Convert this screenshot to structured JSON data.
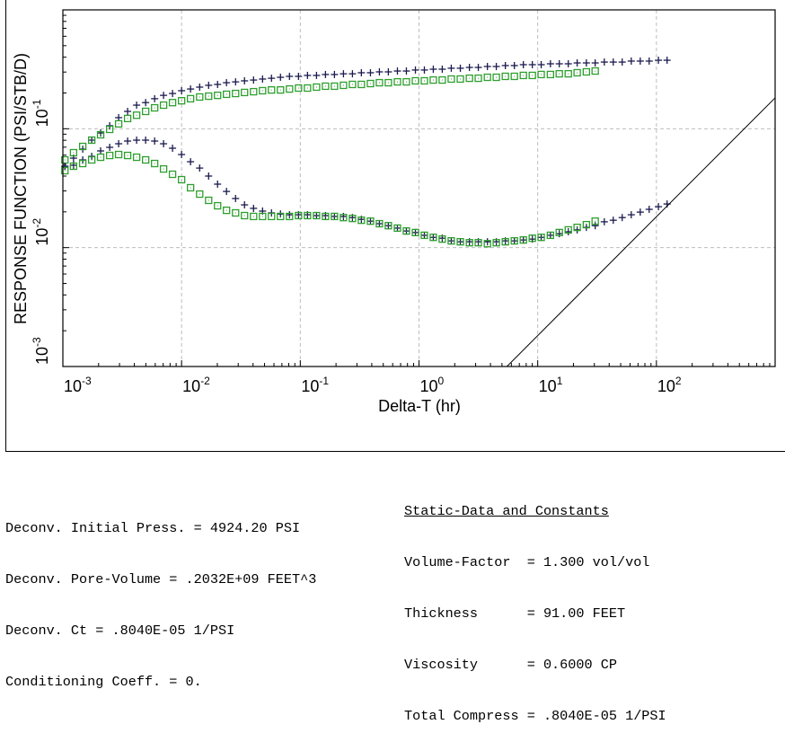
{
  "chart_data": {
    "type": "scatter",
    "title": "",
    "xlabel": "Delta-T (hr)",
    "ylabel": "RESPONSE FUNCTION (PSI/STB/D)",
    "xscale": "log",
    "yscale": "log",
    "xlim": [
      0.001,
      1000
    ],
    "ylim": [
      0.001,
      1
    ],
    "grid": true,
    "legend": "none",
    "x_ticks": [
      {
        "base": "10",
        "exp": "-3"
      },
      {
        "base": "10",
        "exp": "-2"
      },
      {
        "base": "10",
        "exp": "-1"
      },
      {
        "base": "10",
        "exp": "0"
      },
      {
        "base": "10",
        "exp": "1"
      },
      {
        "base": "10",
        "exp": "2"
      }
    ],
    "y_ticks": [
      {
        "base": "10",
        "exp": "-3"
      },
      {
        "base": "10",
        "exp": "-2"
      },
      {
        "base": "10",
        "exp": "-1"
      }
    ],
    "x": [
      0.00104,
      0.00123,
      0.00147,
      0.00175,
      0.00208,
      0.00248,
      0.00295,
      0.00351,
      0.00418,
      0.00498,
      0.00593,
      0.00705,
      0.00839,
      0.01,
      0.0119,
      0.0142,
      0.0169,
      0.0201,
      0.0239,
      0.0285,
      0.0339,
      0.0404,
      0.0481,
      0.0572,
      0.0681,
      0.0811,
      0.0966,
      0.115,
      0.137,
      0.163,
      0.194,
      0.231,
      0.275,
      0.327,
      0.39,
      0.464,
      0.552,
      0.658,
      0.783,
      0.933,
      1.11,
      1.32,
      1.57,
      1.87,
      2.23,
      2.66,
      3.16,
      3.77,
      4.48,
      5.34,
      6.36,
      7.57,
      9.01,
      10.7,
      12.8,
      15.2,
      18.1,
      21.5,
      25.7,
      30.5,
      36.4,
      43.3,
      51.5,
      61.4,
      73.1,
      86.9,
      104,
      123
    ],
    "series": [
      {
        "name": "response-plus",
        "marker": "plus",
        "color": "#1a1a4e",
        "values": [
          0.0484,
          0.0566,
          0.0674,
          0.0802,
          0.0922,
          0.106,
          0.124,
          0.14,
          0.158,
          0.166,
          0.179,
          0.191,
          0.198,
          0.209,
          0.216,
          0.224,
          0.232,
          0.236,
          0.244,
          0.248,
          0.253,
          0.257,
          0.262,
          0.266,
          0.271,
          0.276,
          0.276,
          0.281,
          0.281,
          0.286,
          0.286,
          0.29,
          0.29,
          0.296,
          0.296,
          0.301,
          0.301,
          0.306,
          0.306,
          0.312,
          0.312,
          0.317,
          0.317,
          0.323,
          0.323,
          0.328,
          0.328,
          0.334,
          0.334,
          0.34,
          0.34,
          0.346,
          0.346,
          0.346,
          0.352,
          0.352,
          0.352,
          0.358,
          0.358,
          0.358,
          0.364,
          0.364,
          0.364,
          0.371,
          0.371,
          0.371,
          0.377,
          0.377
        ]
      },
      {
        "name": "response-square",
        "marker": "square",
        "color": "#2e9e2e",
        "values": [
          0.0547,
          0.0629,
          0.071,
          0.0802,
          0.089,
          0.0988,
          0.11,
          0.122,
          0.13,
          0.14,
          0.15,
          0.158,
          0.166,
          0.172,
          0.179,
          0.185,
          0.188,
          0.191,
          0.195,
          0.198,
          0.202,
          0.205,
          0.209,
          0.212,
          0.212,
          0.216,
          0.22,
          0.22,
          0.224,
          0.228,
          0.228,
          0.232,
          0.236,
          0.236,
          0.24,
          0.244,
          0.244,
          0.248,
          0.248,
          0.253,
          0.253,
          0.257,
          0.257,
          0.262,
          0.262,
          0.266,
          0.266,
          0.271,
          0.271,
          0.276,
          0.276,
          0.281,
          0.281,
          0.286,
          0.286,
          0.29,
          0.29,
          0.296,
          0.301,
          0.306,
          null,
          null,
          null,
          null,
          null,
          null,
          null,
          null
        ]
      },
      {
        "name": "derivative-plus",
        "marker": "plus",
        "color": "#1a1a4e",
        "values": [
          0.0484,
          0.0493,
          0.0547,
          0.0586,
          0.0651,
          0.0698,
          0.0748,
          0.0788,
          0.0802,
          0.0802,
          0.0788,
          0.0748,
          0.0686,
          0.0607,
          0.0528,
          0.0467,
          0.04,
          0.0342,
          0.0297,
          0.0259,
          0.0229,
          0.0214,
          0.0203,
          0.0196,
          0.0192,
          0.0189,
          0.0189,
          0.0189,
          0.0186,
          0.0186,
          0.0183,
          0.0183,
          0.0179,
          0.0173,
          0.0167,
          0.0159,
          0.0153,
          0.0146,
          0.0138,
          0.0134,
          0.0127,
          0.0122,
          0.012,
          0.0114,
          0.0112,
          0.0112,
          0.0112,
          0.0112,
          0.0112,
          0.0114,
          0.0114,
          0.0116,
          0.0118,
          0.0122,
          0.0127,
          0.0131,
          0.0136,
          0.0141,
          0.0148,
          0.0153,
          0.0165,
          0.017,
          0.0179,
          0.0189,
          0.0199,
          0.021,
          0.0221,
          0.0233
        ]
      },
      {
        "name": "derivative-square",
        "marker": "square",
        "color": "#2e9e2e",
        "values": [
          0.0444,
          0.0484,
          0.051,
          0.0547,
          0.0576,
          0.0596,
          0.0607,
          0.0596,
          0.0576,
          0.0547,
          0.051,
          0.0459,
          0.0414,
          0.0373,
          0.0319,
          0.0282,
          0.025,
          0.0225,
          0.0206,
          0.0196,
          0.0186,
          0.0183,
          0.0183,
          0.0183,
          0.0183,
          0.0183,
          0.0186,
          0.0186,
          0.0186,
          0.0183,
          0.0183,
          0.0179,
          0.0176,
          0.017,
          0.0167,
          0.0159,
          0.0153,
          0.0146,
          0.0138,
          0.0134,
          0.0127,
          0.0122,
          0.0118,
          0.0114,
          0.0112,
          0.011,
          0.011,
          0.0108,
          0.011,
          0.0112,
          0.0114,
          0.0116,
          0.012,
          0.0122,
          0.0127,
          0.0134,
          0.0141,
          0.0148,
          0.0156,
          0.0167,
          null,
          null,
          null,
          null,
          null,
          null,
          null,
          null
        ]
      }
    ],
    "reference_line": {
      "name": "unit-slope-line",
      "color": "#000000",
      "slope": 1,
      "points": [
        [
          5.5,
          0.001
        ],
        [
          1000,
          0.182
        ]
      ]
    }
  },
  "info_left": [
    "Deconv. Initial Press. = 4924.20 PSI",
    "Deconv. Pore-Volume = .2032E+09 FEET^3",
    "Deconv. Ct = .8040E-05 1/PSI",
    "Conditioning Coeff. = 0."
  ],
  "info_right": {
    "heading": "Static-Data and Constants",
    "rows": [
      "Volume-Factor  = 1.300 vol/vol",
      "Thickness      = 91.00 FEET",
      "Viscosity      = 0.6000 CP",
      "Total Compress = .8040E-05 1/PSI"
    ]
  }
}
